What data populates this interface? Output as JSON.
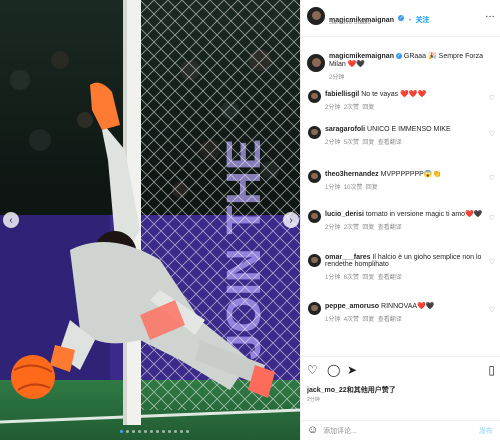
{
  "post": {
    "author": "magicmikemaignan",
    "follow_label": "关注",
    "location": "San Siro Stadio",
    "caption": "GRaaa 🎉 Sempre Forza Milan ❤️🖤",
    "caption_age": "2分钟",
    "comments": [
      {
        "user": "fabiellisgil",
        "text": "No te vayas ❤️❤️❤️",
        "age": "2分钟",
        "likes": "2次赞",
        "reply": "回复",
        "translate": ""
      },
      {
        "user": "saragarofoli",
        "text": "UNICO E IMMENSO MIKE",
        "age": "2分钟",
        "likes": "5次赞",
        "reply": "回复",
        "translate": "查看翻译"
      },
      {
        "user": "theo3hernandez",
        "text": "MVPPPPPPP😱👏",
        "age": "1分钟",
        "likes": "10次赞",
        "reply": "回复",
        "translate": ""
      },
      {
        "user": "lucio_derisi",
        "text": "tornato in versione magic ti amo❤️🖤",
        "age": "2分钟",
        "likes": "2次赞",
        "reply": "回复",
        "translate": "查看翻译"
      },
      {
        "user": "omar___fares",
        "text": "Il halcio è un gioho semplice non lo rendethe homplihato",
        "age": "1分钟",
        "likes": "6次赞",
        "reply": "回复",
        "translate": "查看翻译"
      },
      {
        "user": "peppe_amoruso",
        "text": "RINNOVAA❤️🖤",
        "age": "1分钟",
        "likes": "4次赞",
        "reply": "回复",
        "translate": "查看翻译"
      }
    ],
    "liked_by": "jack_mo_22和其他用户赞了",
    "post_age": "2分钟",
    "comment_placeholder": "添加评论...",
    "post_label": "发布"
  },
  "colors": {
    "accent": "#0095f6",
    "verified": "#3897f0",
    "milan_red": "#c8102e"
  },
  "icons": {
    "prev": "chevron-left-icon",
    "next": "chevron-right-icon",
    "like": "heart-icon",
    "comment": "comment-icon",
    "share": "send-icon",
    "save": "bookmark-icon",
    "emoji": "emoji-icon"
  }
}
